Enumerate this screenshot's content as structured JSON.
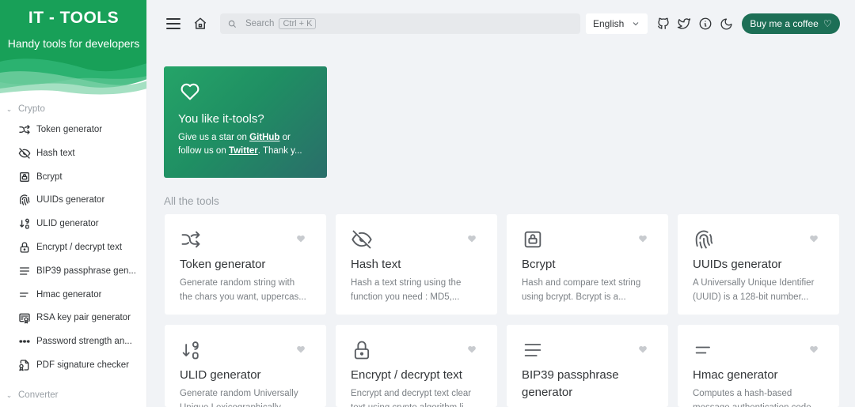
{
  "brand": {
    "title": "IT - TOOLS",
    "subtitle": "Handy tools for developers",
    "colors": {
      "primary": "#18a058",
      "dark": "#1d6f56",
      "light": "#4cc38a"
    }
  },
  "sidebar": {
    "groups": [
      {
        "label": "Crypto",
        "items": [
          {
            "label": "Token generator",
            "icon": "shuffle-icon"
          },
          {
            "label": "Hash text",
            "icon": "eye-off-icon"
          },
          {
            "label": "Bcrypt",
            "icon": "lock-square-icon"
          },
          {
            "label": "UUIDs generator",
            "icon": "fingerprint-icon"
          },
          {
            "label": "ULID generator",
            "icon": "sort-numeric-icon"
          },
          {
            "label": "Encrypt / decrypt text",
            "icon": "lock-icon"
          },
          {
            "label": "BIP39 passphrase gen...",
            "icon": "align-justified-icon"
          },
          {
            "label": "Hmac generator",
            "icon": "short-text-icon"
          },
          {
            "label": "RSA key pair generator",
            "icon": "certificate-icon"
          },
          {
            "label": "Password strength an...",
            "icon": "password-icon"
          },
          {
            "label": "PDF signature checker",
            "icon": "file-certificate-icon"
          }
        ]
      },
      {
        "label": "Converter",
        "items": []
      }
    ]
  },
  "header": {
    "search": {
      "placeholder": "Search",
      "shortcut": "Ctrl + K"
    },
    "language": "English",
    "coffee_label": "Buy me a coffee"
  },
  "promo": {
    "title": "You like it-tools?",
    "text_before": "Give us a star on ",
    "github_link": "GitHub",
    "text_middle": " or follow us on ",
    "twitter_link": "Twitter",
    "text_after": ". Thank y..."
  },
  "main": {
    "section_title": "All the tools",
    "tools": [
      {
        "title": "Token generator",
        "desc1": "Generate random string with",
        "desc2": "the chars you want, uppercas...",
        "icon": "shuffle-icon"
      },
      {
        "title": "Hash text",
        "desc1": "Hash a text string using the",
        "desc2": "function you need : MD5,...",
        "icon": "eye-off-icon"
      },
      {
        "title": "Bcrypt",
        "desc1": "Hash and compare text string",
        "desc2": "using bcrypt. Bcrypt is a...",
        "icon": "lock-square-icon"
      },
      {
        "title": "UUIDs generator",
        "desc1": "A Universally Unique Identifier",
        "desc2": "(UUID) is a 128-bit number...",
        "icon": "fingerprint-icon"
      },
      {
        "title": "ULID generator",
        "desc1": "Generate random Universally",
        "desc2": "Unique Lexicographically...",
        "icon": "sort-numeric-icon"
      },
      {
        "title": "Encrypt / decrypt text",
        "desc1": "Encrypt and decrypt text clear",
        "desc2": "text using crypto algorithm li...",
        "icon": "lock-icon"
      },
      {
        "title": "BIP39 passphrase generator",
        "desc1": "",
        "desc2": "",
        "icon": "align-justified-icon"
      },
      {
        "title": "Hmac generator",
        "desc1": "Computes a hash-based",
        "desc2": "message authentication code...",
        "icon": "short-text-icon"
      }
    ]
  }
}
